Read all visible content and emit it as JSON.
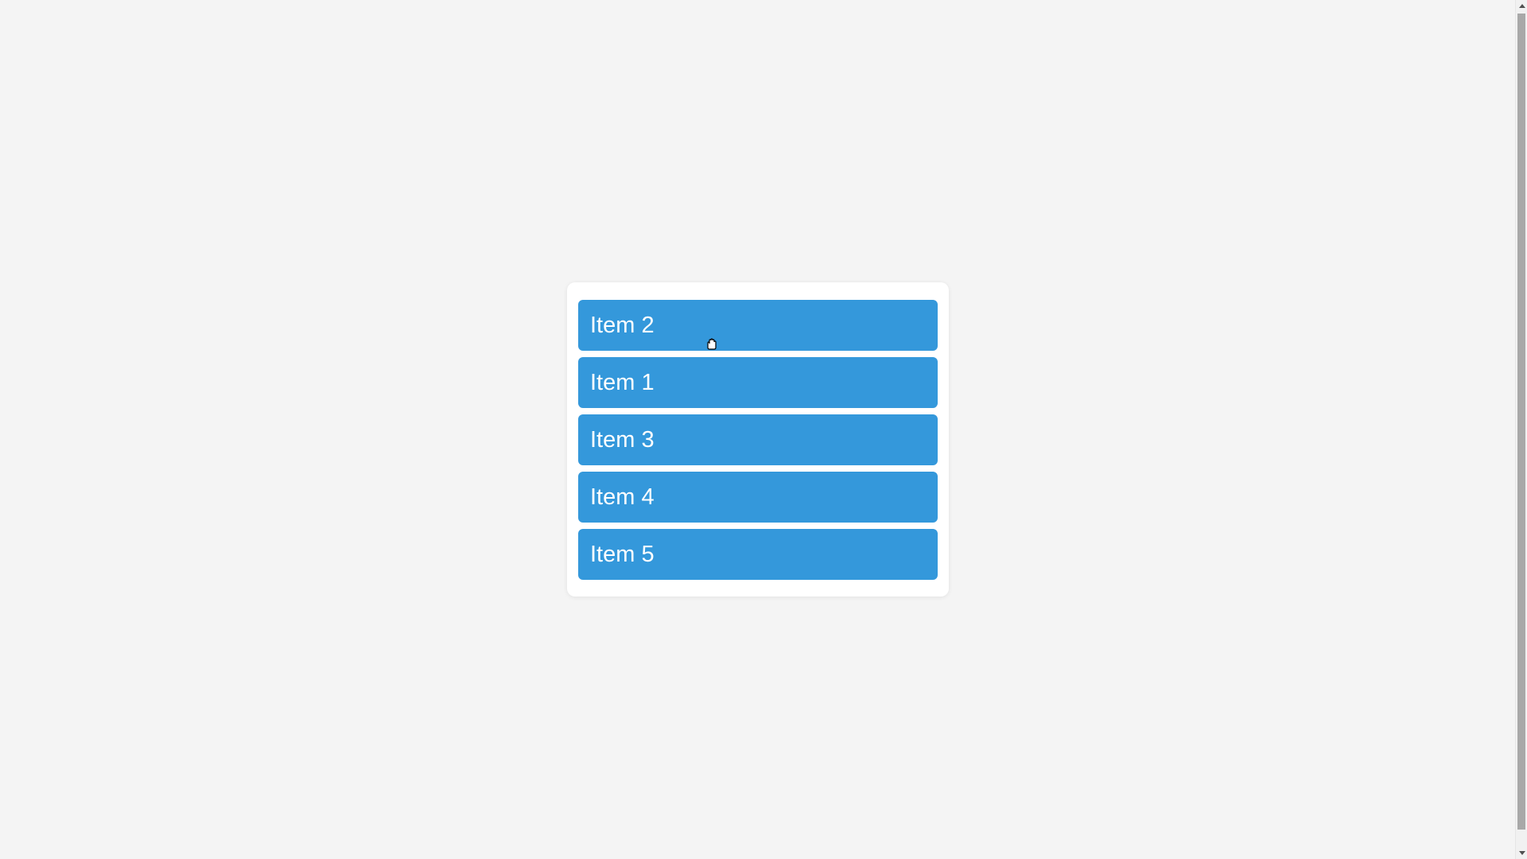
{
  "list": {
    "items": [
      {
        "label": "Item 2"
      },
      {
        "label": "Item 1"
      },
      {
        "label": "Item 3"
      },
      {
        "label": "Item 4"
      },
      {
        "label": "Item 5"
      }
    ]
  },
  "colors": {
    "background": "#f4f4f4",
    "panel": "#ffffff",
    "item": "#3498db",
    "item_text": "#ffffff"
  },
  "icons": {
    "cursor": "grab-hand-cursor-icon",
    "scroll_up": "triangle-up-icon",
    "scroll_down": "triangle-down-icon"
  }
}
